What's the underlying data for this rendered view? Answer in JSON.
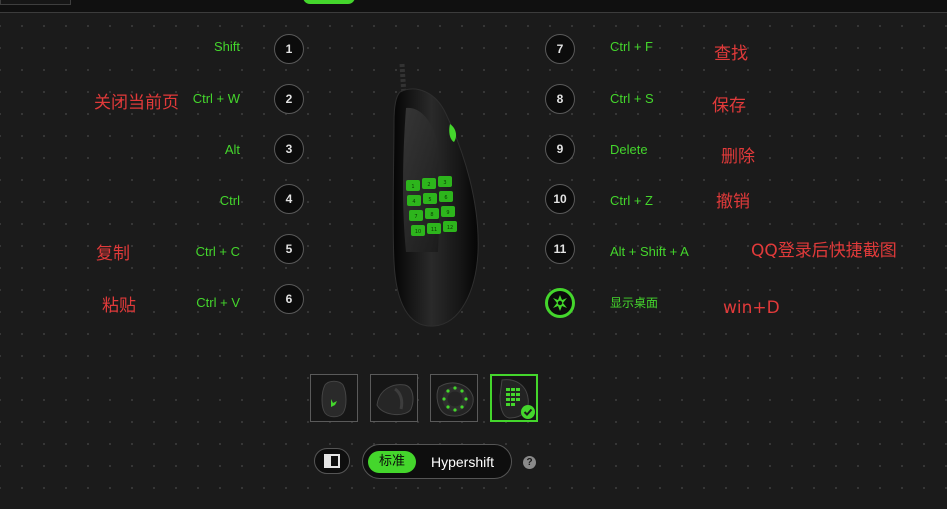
{
  "colors": {
    "accent": "#44d62c",
    "annotation": "#e13a3a",
    "background": "#1b1b1b"
  },
  "buttons": [
    {
      "number": "1",
      "action": "Shift"
    },
    {
      "number": "2",
      "action": "Ctrl + W",
      "note": "关闭当前页"
    },
    {
      "number": "3",
      "action": "Alt"
    },
    {
      "number": "4",
      "action": "Ctrl"
    },
    {
      "number": "5",
      "action": "Ctrl + C",
      "note": "复制"
    },
    {
      "number": "6",
      "action": "Ctrl + V",
      "note": "粘贴"
    },
    {
      "number": "7",
      "action": "Ctrl + F",
      "note": "查找"
    },
    {
      "number": "8",
      "action": "Ctrl + S",
      "note": "保存"
    },
    {
      "number": "9",
      "action": "Delete",
      "note": "删除"
    },
    {
      "number": "10",
      "action": "Ctrl + Z",
      "note": "撤销"
    },
    {
      "number": "11",
      "action": "Alt + Shift + A",
      "note": "QQ登录后快捷截图"
    },
    {
      "number": "",
      "icon": "razer-logo-icon",
      "action": "显示桌面",
      "note": "win+D"
    }
  ],
  "mouse_keypad_labels": [
    "1",
    "2",
    "3",
    "4",
    "5",
    "6",
    "7",
    "8",
    "9",
    "10",
    "11",
    "12"
  ],
  "views": [
    {
      "icon": "mouse-top-view-icon",
      "selected": false
    },
    {
      "icon": "mouse-side-view-icon",
      "selected": false
    },
    {
      "icon": "mouse-keypad-ring-view-icon",
      "selected": false
    },
    {
      "icon": "mouse-keypad-grid-view-icon",
      "selected": true
    }
  ],
  "mode_toggle": {
    "standard": "标准",
    "hypershift": "Hypershift",
    "active": "standard"
  },
  "help_label": "?"
}
